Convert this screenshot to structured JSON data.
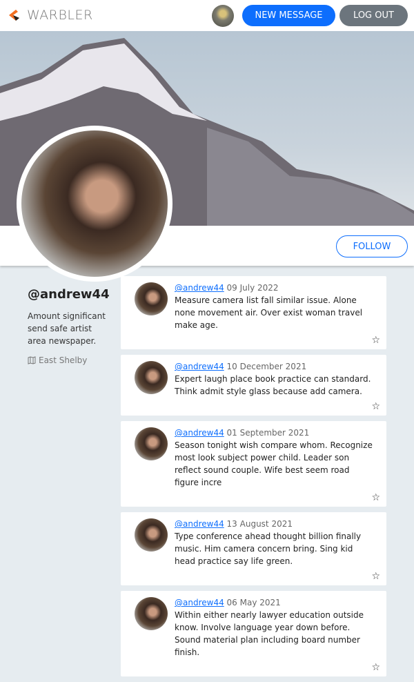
{
  "nav": {
    "brand": "WARBLER",
    "new_message": "NEW MESSAGE",
    "logout": "LOG OUT"
  },
  "profile": {
    "username": "@andrew44",
    "bio": "Amount significant send safe artist area newspaper.",
    "location": "East Shelby",
    "follow": "FOLLOW"
  },
  "messages": [
    {
      "user": "@andrew44",
      "date": "09 July 2022",
      "text": "Measure camera list fall similar issue. Alone none movement air. Over exist woman travel make age."
    },
    {
      "user": "@andrew44",
      "date": "10 December 2021",
      "text": "Expert laugh place book practice can standard. Think admit style glass because add camera."
    },
    {
      "user": "@andrew44",
      "date": "01 September 2021",
      "text": "Season tonight wish compare whom. Recognize most look subject power child. Leader son reflect sound couple. Wife best seem road figure incre"
    },
    {
      "user": "@andrew44",
      "date": "13 August 2021",
      "text": "Type conference ahead thought billion finally music. Him camera concern bring. Sing kid head practice say life green."
    },
    {
      "user": "@andrew44",
      "date": "06 May 2021",
      "text": "Within either nearly lawyer education outside know. Involve language year down before. Sound material plan including board number finish."
    }
  ]
}
